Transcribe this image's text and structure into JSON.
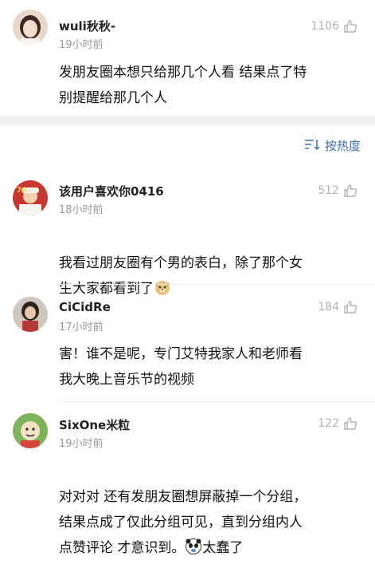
{
  "comments_top": {
    "name": "wuli秋秋-",
    "time": "19小时前",
    "likes": "1106",
    "text": "发朋友圈本想只给那几个人看 结果点了特\n别提醒给那几个人"
  },
  "sort": {
    "label": "按热度"
  },
  "comments": [
    {
      "name": "该用户喜欢你0416",
      "time": "18小时前",
      "likes": "512",
      "text": "我看过朋友圈有个男的表白，除了那个女\n生大家都看到了"
    },
    {
      "name": "CiCidRe",
      "time": "17小时前",
      "likes": "184",
      "text": "害！谁不是呢，专门艾特我家人和老师看\n我大晚上音乐节的视频"
    },
    {
      "name": "SixOne米粒",
      "time": "19小时前",
      "likes": "122",
      "text_a": "对对对 还有发朋友圈想屏蔽掉一个分组，\n结果点成了仅此分组可见，直到分组内人\n点赞评论 才意识到。",
      "text_b": "太蠢了"
    }
  ],
  "colors": {
    "accent": "#3b6fb0",
    "muted": "#9a9a9a",
    "divider": "#f0f0f2"
  },
  "icons": [
    "thumb-up-icon",
    "sort-icon",
    "doge-emoji",
    "panda-emoji"
  ]
}
